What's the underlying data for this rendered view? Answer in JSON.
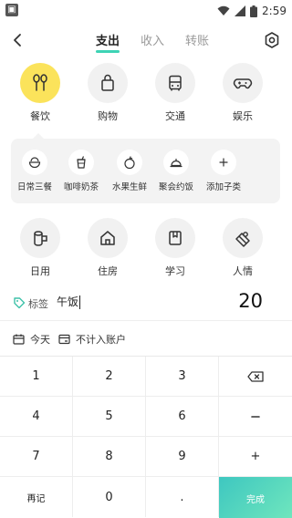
{
  "status_bar": {
    "time": "2:59"
  },
  "header": {
    "tabs": [
      {
        "label": "支出",
        "active": true
      },
      {
        "label": "收入",
        "active": false
      },
      {
        "label": "转账",
        "active": false
      }
    ]
  },
  "categories": [
    {
      "label": "餐饮",
      "icon": "utensils-icon",
      "active": true
    },
    {
      "label": "购物",
      "icon": "shopping-bag-icon",
      "active": false
    },
    {
      "label": "交通",
      "icon": "bus-icon",
      "active": false
    },
    {
      "label": "娱乐",
      "icon": "gamepad-icon",
      "active": false
    },
    {
      "label": "日用",
      "icon": "tissue-roll-icon",
      "active": false
    },
    {
      "label": "住房",
      "icon": "house-icon",
      "active": false
    },
    {
      "label": "学习",
      "icon": "book-icon",
      "active": false
    },
    {
      "label": "人情",
      "icon": "gift-icon",
      "active": false
    }
  ],
  "subcategories": [
    {
      "label": "日常三餐",
      "icon": "bowl-icon"
    },
    {
      "label": "咖啡奶茶",
      "icon": "cup-icon"
    },
    {
      "label": "水果生鲜",
      "icon": "fruit-icon"
    },
    {
      "label": "聚会约饭",
      "icon": "dome-icon"
    },
    {
      "label": "添加子类",
      "icon": "plus-icon"
    }
  ],
  "note": {
    "tag_label": "标签",
    "value": "午饭"
  },
  "amount": "20",
  "options": {
    "date_label": "今天",
    "exclude_label": "不计入账户"
  },
  "keypad": {
    "keys": [
      "1",
      "2",
      "3",
      "4",
      "5",
      "6",
      "7",
      "8",
      "9",
      "+"
    ],
    "remark": "再记",
    "zero": "0",
    "dot": ".",
    "done": "完成"
  },
  "colors": {
    "accent": "#3ed3b5",
    "selected_category": "#fbe35b"
  }
}
